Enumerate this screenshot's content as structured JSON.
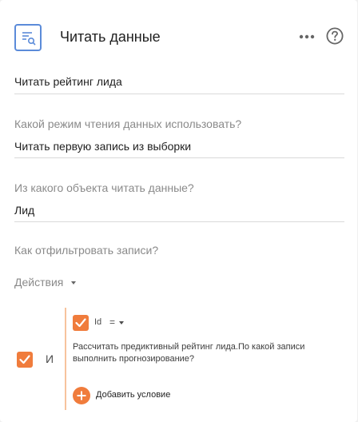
{
  "header": {
    "title": "Читать данные",
    "icon": "document-search-icon",
    "more_icon": "more-dots-icon",
    "help_icon": "help-icon"
  },
  "element_name": {
    "value": "Читать рейтинг лида"
  },
  "read_mode": {
    "label": "Какой режим чтения данных использовать?",
    "value": "Читать первую запись из выборки"
  },
  "source_object": {
    "label": "Из какого объекта читать данные?",
    "value": "Лид"
  },
  "filter": {
    "label": "Как отфильтровать записи?",
    "actions_label": "Действия",
    "group_operator": "И",
    "condition": {
      "field": "Id",
      "operator": "=",
      "value": "Рассчитать предиктивный рейтинг лида.По какой записи выполнить прогнозирование?"
    },
    "add_condition_label": "Добавить условие"
  },
  "colors": {
    "accent": "#f07c3c",
    "icon_blue": "#5b8bd9",
    "group_border": "#f7c39d"
  }
}
